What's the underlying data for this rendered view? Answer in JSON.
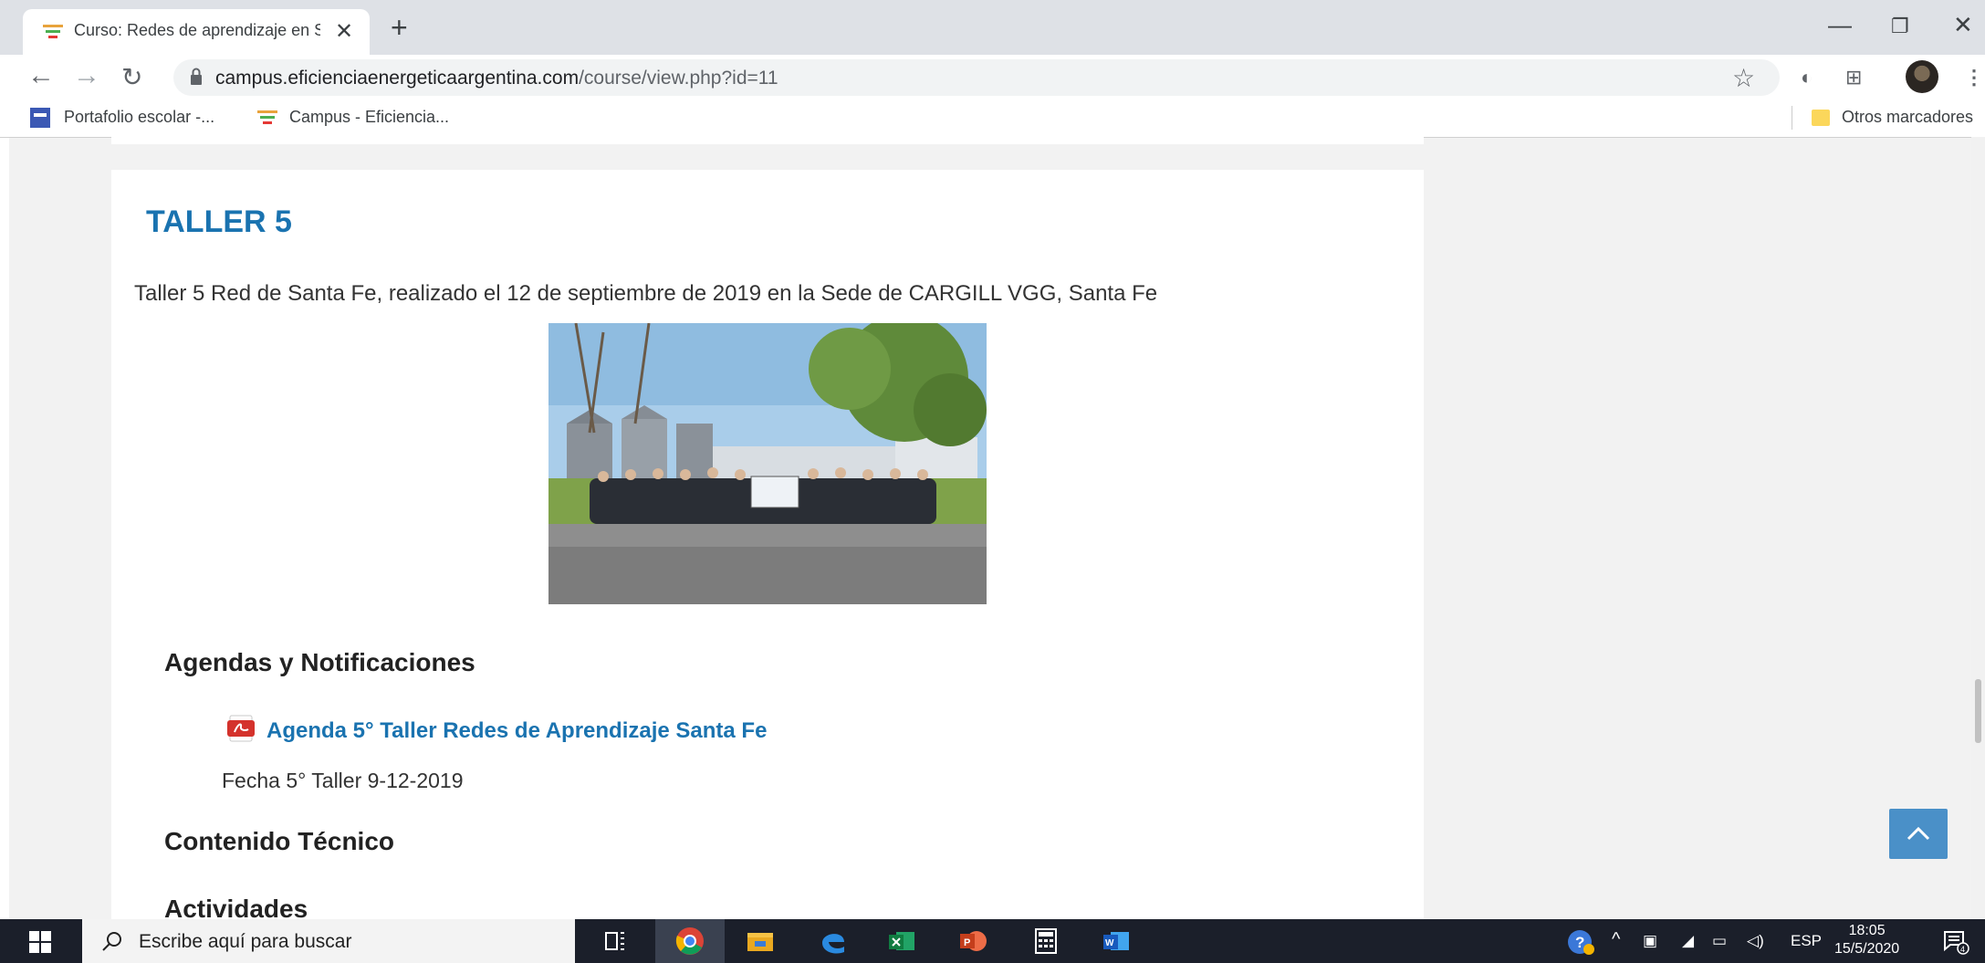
{
  "browser": {
    "tab_title": "Curso: Redes de aprendizaje en S",
    "url_host": "campus.eficienciaenergeticaargentina.com",
    "url_path": "/course/view.php?id=11",
    "bookmarks": [
      "Portafolio escolar -...",
      "Campus - Eficiencia..."
    ],
    "other_bookmarks": "Otros marcadores"
  },
  "page": {
    "section_title": "TALLER 5",
    "summary": "Taller 5 Red de Santa Fe, realizado el 12 de septiembre de 2019 en la Sede de CARGILL VGG,  Santa Fe",
    "sub1": "Agendas y Notificaciones",
    "resource_link": "Agenda 5° Taller Redes de Aprendizaje Santa Fe",
    "resource_note": "Fecha 5° Taller 9-12-2019",
    "sub2": "Contenido Técnico",
    "sub3": "Actividades"
  },
  "taskbar": {
    "search_placeholder": "Escribe aquí para buscar",
    "lang": "ESP",
    "time": "18:05",
    "date": "15/5/2020",
    "notif_count": "4"
  }
}
